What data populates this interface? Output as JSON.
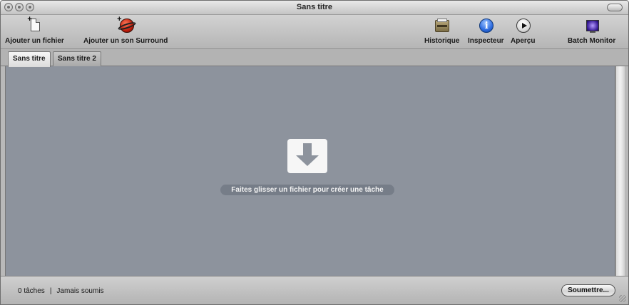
{
  "window": {
    "title": "Sans titre"
  },
  "toolbar": {
    "add_file": {
      "label": "Ajouter un fichier",
      "icon": "add-file-icon"
    },
    "add_surround": {
      "label": "Ajouter un son Surround",
      "icon": "surround-sound-icon"
    },
    "history": {
      "label": "Historique",
      "icon": "history-drawer-icon"
    },
    "inspector": {
      "label": "Inspecteur",
      "icon": "info-icon"
    },
    "preview": {
      "label": "Aperçu",
      "icon": "play-icon"
    },
    "batch_monitor": {
      "label": "Batch Monitor",
      "icon": "monitor-icon"
    }
  },
  "tabs": [
    {
      "label": "Sans titre",
      "active": true
    },
    {
      "label": "Sans titre 2",
      "active": false
    }
  ],
  "main": {
    "drop_hint": "Faites glisser un fichier pour créer une tâche",
    "drop_icon": "download-arrow-icon",
    "background_color": "#8d939d"
  },
  "status": {
    "tasks": "0 tâches",
    "separator": "|",
    "submitted": "Jamais soumis",
    "submit_label": "Soumettre..."
  }
}
